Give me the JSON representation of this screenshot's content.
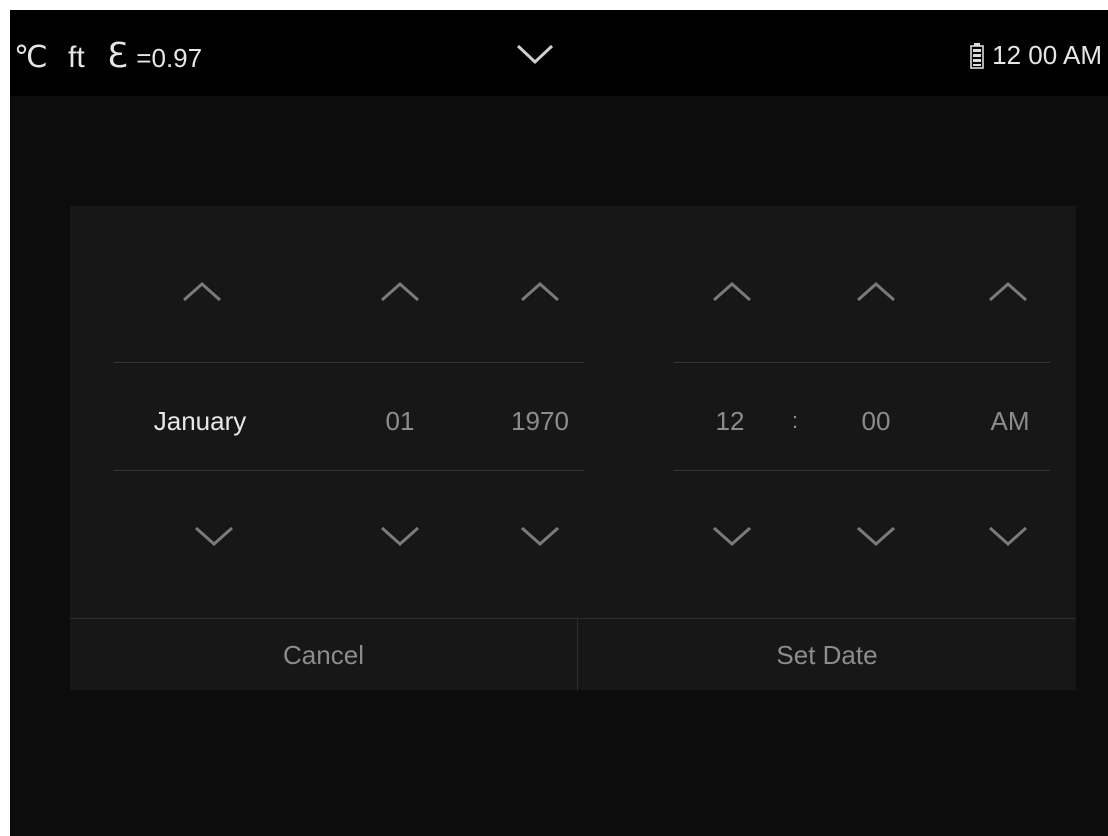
{
  "status": {
    "temp_unit": "℃",
    "distance_unit": "ft",
    "emissivity_symbol": "ℇ",
    "emissivity_value": "=0.97",
    "time": "12 00 AM",
    "icons": {
      "center": "chevron-down-icon",
      "battery": "battery-icon"
    }
  },
  "picker": {
    "date": {
      "month": "January",
      "day": "01",
      "year": "1970"
    },
    "time": {
      "hour": "12",
      "separator": ":",
      "minute": "00",
      "period": "AM"
    },
    "active_field": "month"
  },
  "actions": {
    "cancel_label": "Cancel",
    "set_label": "Set Date"
  },
  "colors": {
    "background": "#0c0c0c",
    "panel": "#171717",
    "active_text": "#e8e8e8",
    "inactive_text": "#8c8c8c",
    "divider": "#333333"
  }
}
